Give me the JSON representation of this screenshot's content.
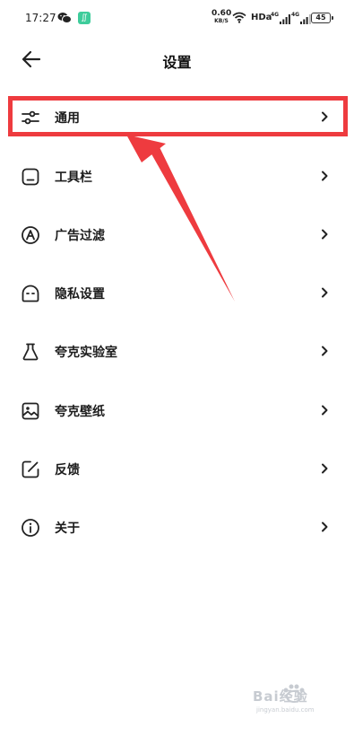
{
  "status_bar": {
    "time": "17:27",
    "net_speed": "0.60",
    "net_speed_unit": "KB/S",
    "hd": "HDa",
    "signal_1": "4G",
    "signal_2": "4G",
    "battery": "45",
    "app_badge": "∬"
  },
  "header": {
    "title": "设置"
  },
  "menu": {
    "items": [
      {
        "label": "通用",
        "icon": "sliders-icon"
      },
      {
        "label": "工具栏",
        "icon": "toolbar-icon"
      },
      {
        "label": "广告过滤",
        "icon": "ad-filter-icon"
      },
      {
        "label": "隐私设置",
        "icon": "privacy-mask-icon"
      },
      {
        "label": "夸克实验室",
        "icon": "flask-icon"
      },
      {
        "label": "夸克壁纸",
        "icon": "wallpaper-icon"
      },
      {
        "label": "反馈",
        "icon": "feedback-edit-icon"
      },
      {
        "label": "关于",
        "icon": "info-icon"
      }
    ]
  },
  "annotation": {
    "highlight_color": "#ee3b3f",
    "arrow_color": "#ee3b3f",
    "target": "通用"
  },
  "watermark": {
    "text": "Bai经验",
    "url": "jingyan.baidu.com"
  }
}
